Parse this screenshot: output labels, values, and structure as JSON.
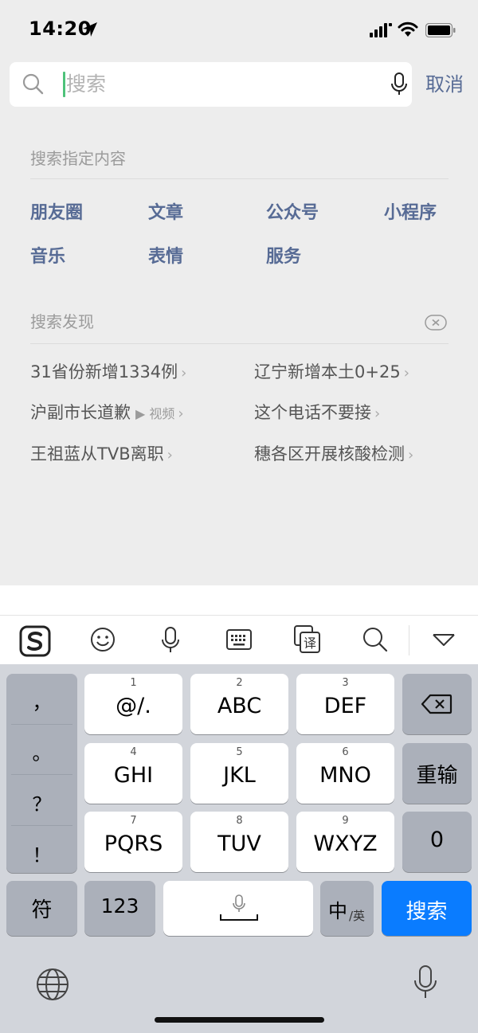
{
  "status_bar": {
    "time": "14:20"
  },
  "search": {
    "placeholder": "搜索",
    "cancel_label": "取消"
  },
  "specified_content": {
    "title": "搜索指定内容",
    "categories": [
      "朋友圈",
      "文章",
      "公众号",
      "小程序",
      "音乐",
      "表情",
      "服务"
    ]
  },
  "discovery": {
    "title": "搜索发现",
    "items": [
      {
        "text": "31省份新增1334例",
        "tag": ""
      },
      {
        "text": "辽宁新增本土0+25",
        "tag": ""
      },
      {
        "text": "沪副市长道歉",
        "tag": "视频"
      },
      {
        "text": "这个电话不要接",
        "tag": ""
      },
      {
        "text": "王祖蓝从TVB离职",
        "tag": ""
      },
      {
        "text": "穗各区开展核酸检测",
        "tag": ""
      }
    ],
    "arrow": "›",
    "video_marker": "▶"
  },
  "keyboard": {
    "toolbar_icons": [
      "sogou-logo-icon",
      "emoji-icon",
      "microphone-icon",
      "keyboard-icon",
      "translate-icon",
      "search-icon",
      "collapse-icon"
    ],
    "translate_glyph": "译",
    "punctuation": [
      "，",
      "。",
      "？",
      "！"
    ],
    "keys": [
      {
        "num": "1",
        "label": "@/."
      },
      {
        "num": "2",
        "label": "ABC"
      },
      {
        "num": "3",
        "label": "DEF"
      },
      {
        "num": "4",
        "label": "GHI"
      },
      {
        "num": "5",
        "label": "JKL"
      },
      {
        "num": "6",
        "label": "MNO"
      },
      {
        "num": "7",
        "label": "PQRS"
      },
      {
        "num": "8",
        "label": "TUV"
      },
      {
        "num": "9",
        "label": "WXYZ"
      }
    ],
    "retype_label": "重输",
    "zero_label": "0",
    "symbol_label": "符",
    "numbers_label": "123",
    "lang_main": "中",
    "lang_sub": "/英",
    "search_label": "搜索",
    "accent_color": "#0a7cff"
  }
}
